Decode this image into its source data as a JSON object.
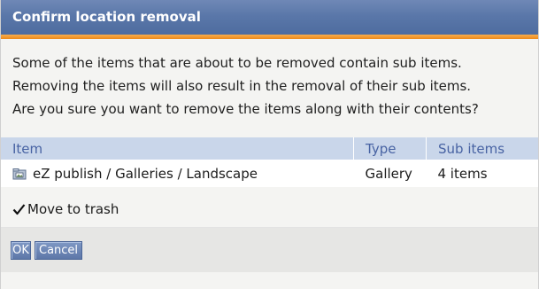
{
  "dialog": {
    "title": "Confirm location removal",
    "message_lines": [
      "Some of the items that are about to be removed contain sub items.",
      "Removing the items will also result in the removal of their sub items.",
      "Are you sure you want to remove the items along with their contents?"
    ]
  },
  "table": {
    "headers": [
      "Item",
      "Type",
      "Sub items"
    ],
    "rows": [
      {
        "item": "eZ publish / Galleries / Landscape",
        "type": "Gallery",
        "sub_items": "4 items",
        "icon": "gallery-folder-icon"
      }
    ]
  },
  "trash": {
    "label": "Move to trash",
    "checked": true
  },
  "buttons": {
    "ok": "OK",
    "cancel": "Cancel"
  },
  "colors": {
    "title_bar": "#5a77a9",
    "accent_strip": "#ee8a19",
    "header_bg": "#c9d6ea",
    "header_text": "#4863a3"
  }
}
